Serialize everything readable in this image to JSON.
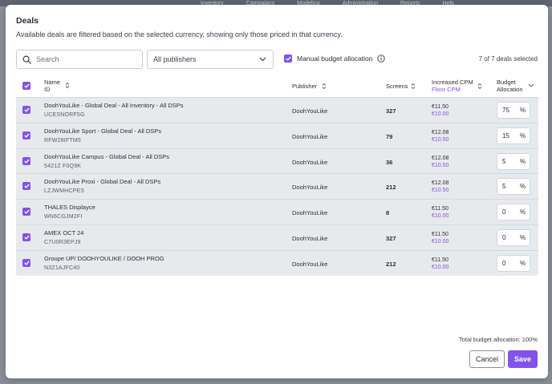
{
  "background_nav": [
    "Inventory",
    "Campaigns",
    "Modeling",
    "Administration",
    "Reports",
    "Help"
  ],
  "dialog": {
    "title": "Deals",
    "subtitle": "Available deals are filtered based on the selected currency, showing only those priced in that currency."
  },
  "filters": {
    "search_placeholder": "Search",
    "search_value": "",
    "publisher_selected": "All publishers",
    "manual_budget_label": "Manual budget allocation",
    "manual_budget_checked": true,
    "selected_count": "7 of 7 deals selected"
  },
  "table": {
    "columns": {
      "name": "Name",
      "id": "ID",
      "publisher": "Publisher",
      "screens": "Screens",
      "cpm": "Increased CPM",
      "floor_cpm": "Floor CPM",
      "budget_line1": "Budget",
      "budget_line2": "Allocation"
    },
    "rows": [
      {
        "name": "DoohYouLike - Global Deal - All Inventory - All DSPs",
        "id": "UCESNORF5G",
        "publisher": "DoohYouLike",
        "screens": "327",
        "cpm": "€11.50",
        "floor": "€10.00",
        "allocation": "75",
        "pct": "%"
      },
      {
        "name": "DoohYouLike Sport - Global Deal - All DSPs",
        "id": "RFW28IFTM5",
        "publisher": "DoohYouLike",
        "screens": "79",
        "cpm": "€12.08",
        "floor": "€10.50",
        "allocation": "15",
        "pct": "%"
      },
      {
        "name": "DoohYouLike Campus - Global Deal - All DSPs",
        "id": "5421Z F0Q9K",
        "publisher": "DoohYouLike",
        "screens": "36",
        "cpm": "€12.08",
        "floor": "€10.50",
        "allocation": "5",
        "pct": "%"
      },
      {
        "name": "DoohYouLike Proxi - Global Deal - All DSPs",
        "id": "LZJWMHCPES",
        "publisher": "DoohYouLike",
        "screens": "212",
        "cpm": "€12.08",
        "floor": "€10.50",
        "allocation": "5",
        "pct": "%"
      },
      {
        "name": "THALES Displayce",
        "id": "WN6CGJM2FI",
        "publisher": "DoohYouLike",
        "screens": "8",
        "cpm": "€11.50",
        "floor": "€10.00",
        "allocation": "0",
        "pct": "%"
      },
      {
        "name": "AMEX OCT 24",
        "id": "C7U0R3EPJ9",
        "publisher": "DoohYouLike",
        "screens": "327",
        "cpm": "€11.50",
        "floor": "€10.00",
        "allocation": "0",
        "pct": "%"
      },
      {
        "name": "Groupe UP/ DOOHYOULIKE / DOOH PROG",
        "id": "N3Z1AJFC40",
        "publisher": "DoohYouLike",
        "screens": "212",
        "cpm": "€11.50",
        "floor": "€10.00",
        "allocation": "0",
        "pct": "%"
      }
    ]
  },
  "footer": {
    "total_allocation": "Total budget allocation: 100%",
    "cancel_label": "Cancel",
    "save_label": "Save"
  },
  "colors": {
    "accent": "#8253e8",
    "table_bg": "#e8e9ed"
  },
  "icons": {
    "search": "search-icon",
    "dropdown": "chevron-down-icon",
    "info": "info-icon",
    "sort": "sort-icon",
    "check": "check-icon"
  }
}
